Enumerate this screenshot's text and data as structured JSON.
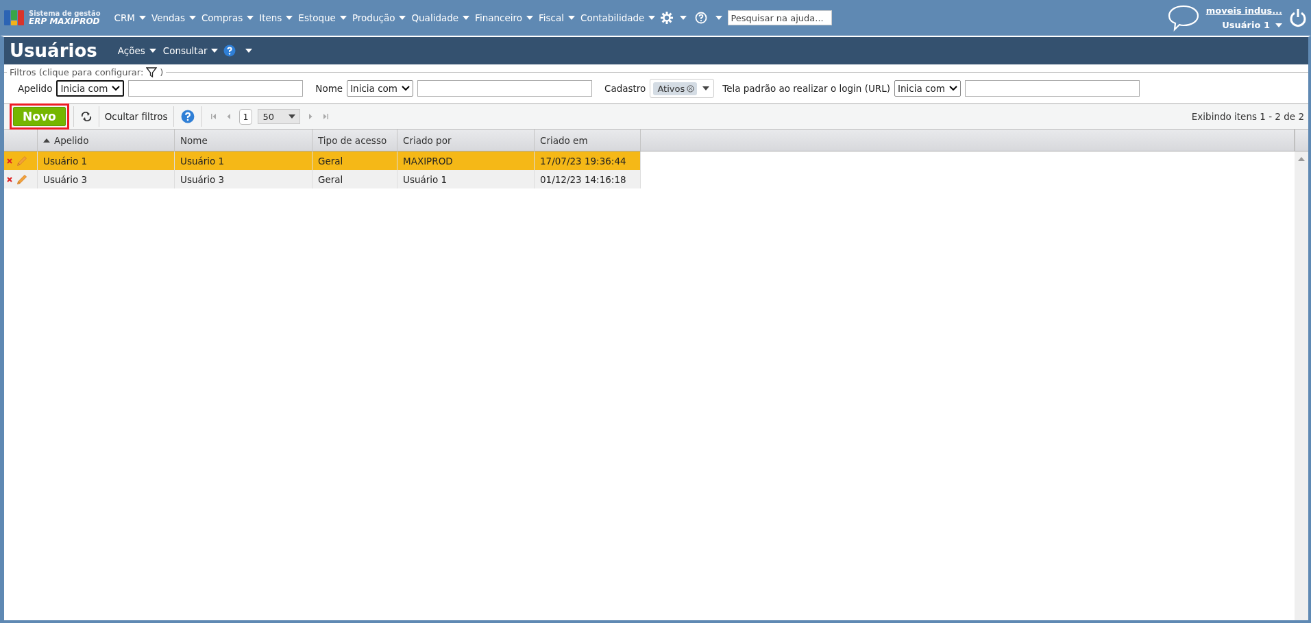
{
  "header": {
    "logo": {
      "line_1": "Sistema de gestão",
      "line_2": "ERP MAXIPROD"
    },
    "menu": [
      {
        "label": "CRM"
      },
      {
        "label": "Vendas"
      },
      {
        "label": "Compras"
      },
      {
        "label": "Itens"
      },
      {
        "label": "Estoque"
      },
      {
        "label": "Produção"
      },
      {
        "label": "Qualidade"
      },
      {
        "label": "Financeiro"
      },
      {
        "label": "Fiscal"
      },
      {
        "label": "Contabilidade"
      }
    ],
    "help_search": {
      "placeholder": "Pesquisar na ajuda..."
    },
    "company_link": "moveis indus...",
    "user_menu": "Usuário 1"
  },
  "page": {
    "title": "Usuários",
    "actions": [
      "Ações",
      "Consultar"
    ]
  },
  "filters": {
    "legend": "Filtros (clique para configurar:",
    "legend_end": ")",
    "fields": [
      {
        "kind": "text",
        "label": "Apelido",
        "mode": "Inicia com",
        "focused": true
      },
      {
        "kind": "text",
        "label": "Nome",
        "mode": "Inicia com",
        "focused": false
      },
      {
        "kind": "tags",
        "label": "Cadastro",
        "tags": [
          "Ativos"
        ]
      },
      {
        "kind": "text",
        "label": "Tela padrão ao realizar o login (URL)",
        "mode": "Inicia com",
        "focused": false
      }
    ]
  },
  "toolbar": {
    "new_button": {
      "label": "Novo",
      "highlighted": true
    },
    "hide_filters": "Ocultar filtros",
    "page": "1",
    "page_size": "50",
    "summary": "Exibindo itens 1 - 2 de 2"
  },
  "table": {
    "columns": [
      {
        "label": "Apelido",
        "sorted": true
      },
      {
        "label": "Nome",
        "sorted": false
      },
      {
        "label": "Tipo de acesso",
        "sorted": false
      },
      {
        "label": "Criado por",
        "sorted": false
      },
      {
        "label": "Criado em",
        "sorted": false
      }
    ],
    "rows": [
      {
        "selected": true,
        "cells": [
          "Usuário 1",
          "Usuário 1",
          "Geral",
          "MAXIPROD",
          "17/07/23 19:36:44"
        ]
      },
      {
        "selected": false,
        "cells": [
          "Usuário 3",
          "Usuário 3",
          "Geral",
          "Usuário 1",
          "01/12/23 14:16:18"
        ]
      }
    ]
  }
}
